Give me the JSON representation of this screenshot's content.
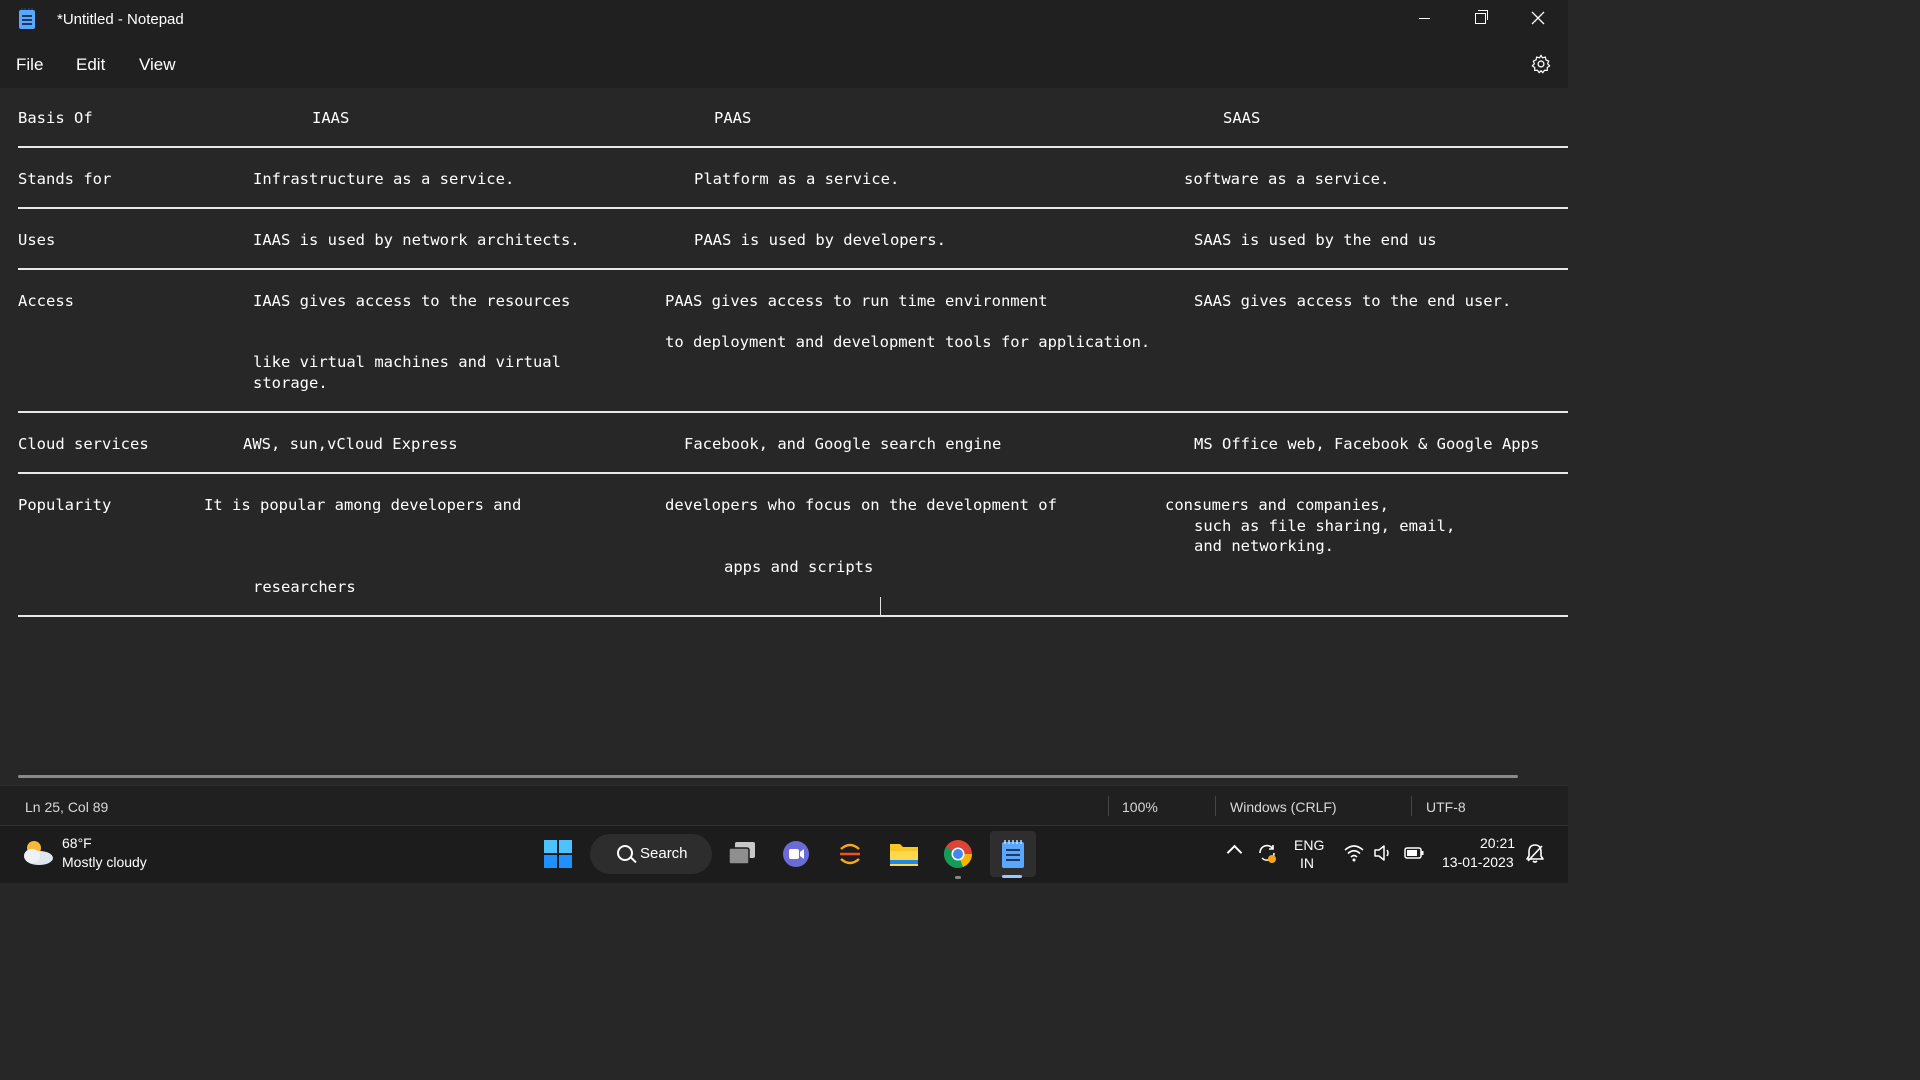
{
  "window": {
    "title": "*Untitled - Notepad"
  },
  "menu": {
    "file": "File",
    "edit": "Edit",
    "view": "View"
  },
  "document": {
    "header": {
      "basis": "Basis Of",
      "iaas": "IAAS",
      "paas": "PAAS",
      "saas": "SAAS"
    },
    "stands_for": {
      "label": "Stands for",
      "iaas": "Infrastructure as a service.",
      "paas": "Platform as a service.",
      "saas": "software as a service."
    },
    "uses": {
      "label": "Uses",
      "iaas": "IAAS is used by network architects.",
      "paas": "PAAS is used by developers.",
      "saas": "SAAS is used by the end us"
    },
    "access": {
      "label": "Access",
      "iaas_line1": "IAAS gives access to the resources",
      "iaas_line2": "like virtual machines and virtual",
      "iaas_line3": "storage.",
      "paas_line1": "PAAS gives access to run time environment",
      "paas_line2": "to deployment and development tools for application.",
      "saas": "SAAS gives access to the end user."
    },
    "cloud_services": {
      "label": "Cloud services",
      "iaas": "AWS, sun,vCloud Express",
      "paas": "Facebook, and Google search engine",
      "saas": "MS Office web, Facebook & Google Apps"
    },
    "popularity": {
      "label": "Popularity",
      "iaas_line1": "It is popular among developers and",
      "iaas_line2": "researchers",
      "paas_line1": "developers who focus on the development of",
      "paas_line2": "apps and scripts",
      "saas_line1": "consumers and companies,",
      "saas_line2": "such as file sharing, email,",
      "saas_line3": "and networking."
    }
  },
  "status": {
    "position": "Ln 25, Col 89",
    "zoom": "100%",
    "line_ending": "Windows (CRLF)",
    "encoding": "UTF-8"
  },
  "taskbar": {
    "weather_temp": "68°F",
    "weather_desc": "Mostly cloudy",
    "search_label": "Search",
    "lang_primary": "ENG",
    "lang_region": "IN",
    "time": "20:21",
    "date": "13-01-2023",
    "icons": [
      "weather-icon",
      "start-icon",
      "search-icon",
      "task-view-icon",
      "chat-icon",
      "media-app-icon",
      "file-explorer-icon",
      "chrome-icon",
      "notepad-icon",
      "chevron-up-icon",
      "sync-icon",
      "wifi-icon",
      "volume-icon",
      "battery-icon",
      "notification-icon"
    ]
  },
  "colors": {
    "editor_bg": "#272727",
    "chrome_bg": "#202020",
    "taskbar_bg": "#1c1c1c",
    "text": "#ffffff",
    "accent": "#5aa7ff"
  }
}
